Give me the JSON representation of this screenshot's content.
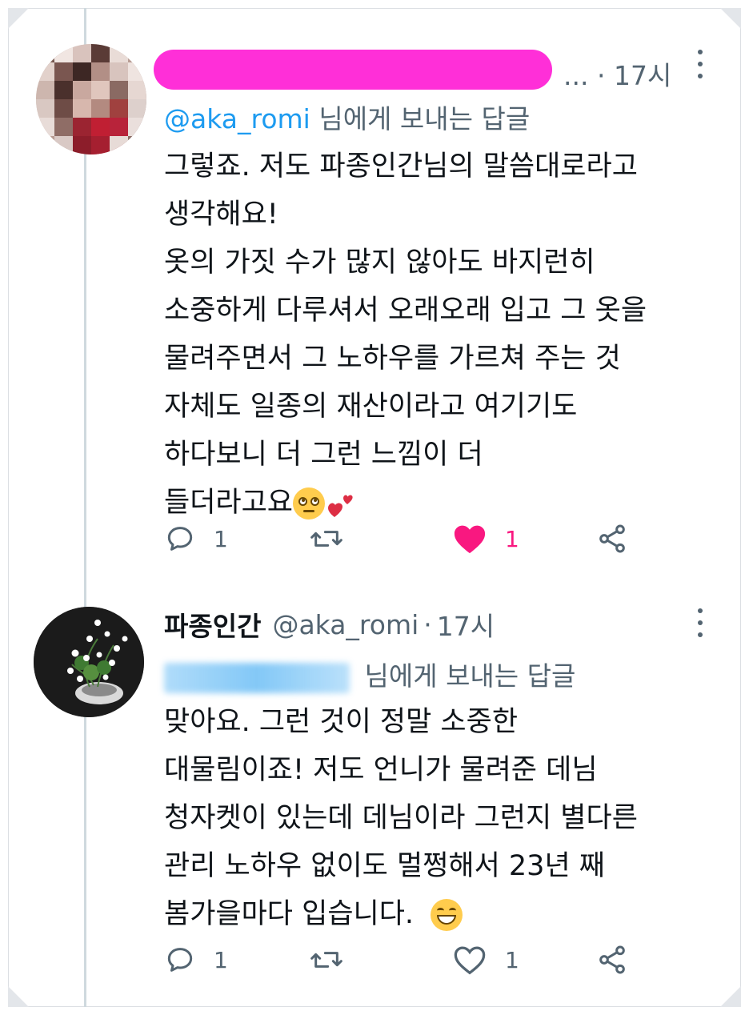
{
  "tweet1": {
    "time": "17시",
    "name_truncation": "...",
    "dot": "·",
    "reply_to_prefix": "@aka_romi",
    "reply_to_suffix": "님에게 보내는 답글",
    "body_lines": [
      "그렇죠. 저도 파종인간님의 말씀대로라고",
      "생각해요!",
      "옷의 가짓 수가 많지 않아도 바지런히",
      "소중하게 다루셔서 오래오래 입고 그 옷을",
      "물려주면서 그 노하우를 가르쳐 주는 것",
      "자체도 일종의 재산이라고 여기기도",
      "하다보니 더 그런 느낌이 더",
      "들더라고요"
    ],
    "emojis": [
      "face-with-rolling-eyes",
      "two-hearts"
    ],
    "actions": {
      "reply_count": "1",
      "retweet_count": "",
      "like_count": "1",
      "liked": true
    }
  },
  "tweet2": {
    "display_name": "파종인간",
    "handle": "@aka_romi",
    "dot": "·",
    "time": "17시",
    "reply_to_suffix": "님에게 보내는 답글",
    "body_lines": [
      "맞아요. 그런 것이 정말 소중한",
      "대물림이죠! 저도 언니가 물려준 데님",
      "청자켓이 있는데 데님이라 그런지 별다른",
      "관리 노하우 없이도 멀쩡해서 23년 째",
      "봄가을마다 입습니다."
    ],
    "emojis": [
      "grinning-face"
    ],
    "actions": {
      "reply_count": "1",
      "retweet_count": "",
      "like_count": "1",
      "liked": false
    }
  },
  "colors": {
    "accent": "#1d9bf0",
    "like": "#f91880",
    "secondary_text": "#536471",
    "censor": "#ff2fd8",
    "thread_line": "#cfd9de"
  }
}
